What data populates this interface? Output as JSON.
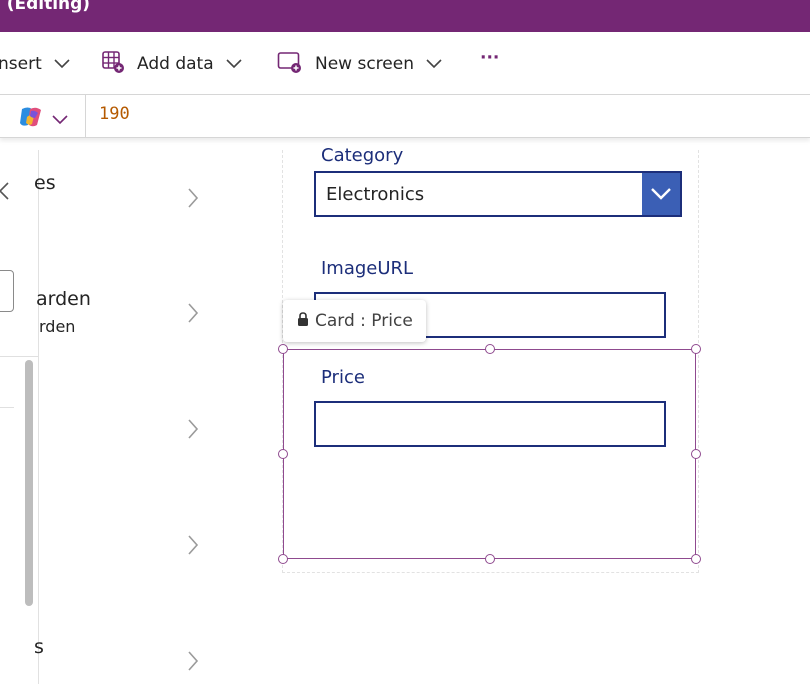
{
  "titlebar": {
    "title": ") (Editing)",
    "color": "#742774"
  },
  "commandbar": {
    "insert_label": "nsert",
    "add_data_label": "Add data",
    "new_screen_label": "New screen",
    "more_label": "···"
  },
  "formulabar": {
    "value": "190",
    "value_color": "#b55a00"
  },
  "leftpanel": {
    "rows": [
      {
        "text": "es"
      },
      {
        "text": "arden",
        "subtext": "rden"
      },
      {
        "text": ""
      },
      {
        "text": ""
      },
      {
        "text": "s"
      }
    ]
  },
  "form": {
    "category_label": "Category",
    "category_value": "Electronics",
    "imageurl_label": "ImageURL",
    "imageurl_value": "",
    "price_label": "Price",
    "price_value": ""
  },
  "tooltip": {
    "text": "Card : Price"
  },
  "colors": {
    "accent": "#742774",
    "field": "#1c2e7a",
    "dropdown_button": "#3b5fb5",
    "selection": "#8f4a8f"
  }
}
